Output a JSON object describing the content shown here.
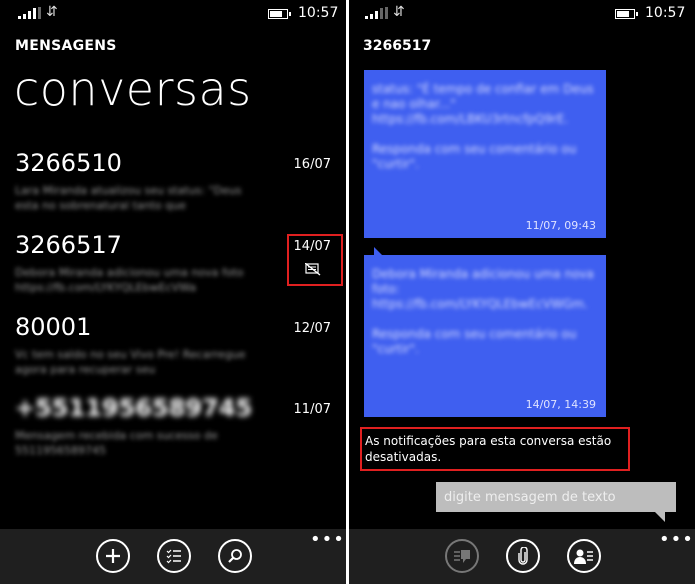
{
  "status": {
    "time": "10:57"
  },
  "inbox": {
    "app_title": "MENSAGENS",
    "pivot_title": "conversas",
    "conversations": [
      {
        "sender": "3266510",
        "date": "16/07",
        "preview": "Lara Miranda atualizou seu status: \"Deus esta no sobrenatural tanto que"
      },
      {
        "sender": "3266517",
        "date": "14/07",
        "preview": "Debora Miranda adicionou uma nova foto https://fb.com/LYKYQLEbwEcVWa"
      },
      {
        "sender": "80001",
        "date": "12/07",
        "preview": "Vc tem saldo no seu Vivo Pre! Recarregue agora para recuperar seu"
      },
      {
        "sender": "+5511956589745",
        "date": "11/07",
        "preview": "Mensagem recebida com sucesso de 5511956589745"
      }
    ],
    "appbar": {
      "more": "•••"
    }
  },
  "thread": {
    "title": "3266517",
    "messages": [
      {
        "text": "status: \"É tempo de confiar em Deus e nao olhar...\" https://fb.com/LBKU3rtncfpQ9rE.\n\nResponda com seu comentário ou \"curtir\".",
        "timestamp": "11/07, 09:43"
      },
      {
        "text": "Debora Miranda adicionou uma nova foto: https://fb.com/LYKYQLEbwEcVWGm.\n\nResponda com seu comentário ou \"curtir\".",
        "timestamp": "14/07, 14:39"
      }
    ],
    "notice": "As notificações para esta conversa estão desativadas.",
    "compose_placeholder": "digite mensagem de texto",
    "appbar": {
      "more": "•••"
    }
  },
  "colors": {
    "background": "#000000",
    "bubble": "#3f5ff0",
    "appbar": "#1f1f1f",
    "highlight": "#e02020",
    "compose": "#bdbdbd"
  }
}
